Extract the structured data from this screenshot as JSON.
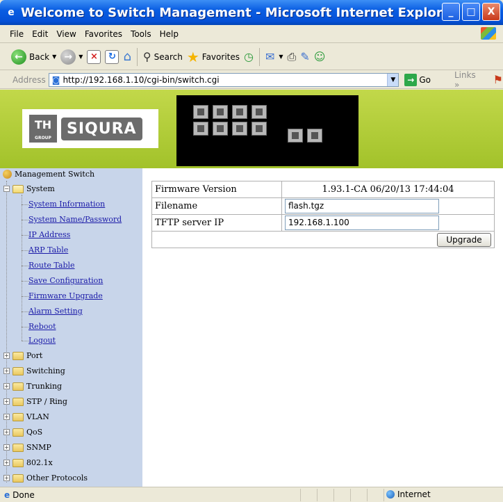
{
  "window": {
    "title": "Welcome to Switch Management - Microsoft Internet Explorer",
    "buttons": [
      "_",
      "□",
      "X"
    ]
  },
  "menu": [
    "File",
    "Edit",
    "View",
    "Favorites",
    "Tools",
    "Help"
  ],
  "toolbar": {
    "back_label": "Back",
    "search_label": "Search",
    "favorites_label": "Favorites"
  },
  "address": {
    "label": "Address",
    "url": "http://192.168.1.10/cgi-bin/switch.cgi",
    "go_label": "Go",
    "links_label": "Links"
  },
  "banner": {
    "logo_group": "TH",
    "logo_group_sub": "GROUP",
    "logo_brand": "SIQURA"
  },
  "sidebar": {
    "root": "Management Switch",
    "system": "System",
    "system_items": [
      "System Information",
      "System Name/Password",
      "IP Address",
      "ARP Table",
      "Route Table",
      "Save Configuration",
      "Firmware Upgrade",
      "Alarm Setting",
      "Reboot",
      "Logout"
    ],
    "folders": [
      "Port",
      "Switching",
      "Trunking",
      "STP / Ring",
      "VLAN",
      "QoS",
      "SNMP",
      "802.1x",
      "Other Protocols"
    ]
  },
  "form": {
    "firmware_label": "Firmware Version",
    "firmware_value": "1.93.1-CA 06/20/13 17:44:04",
    "filename_label": "Filename",
    "filename_value": "flash.tgz",
    "tftp_label": "TFTP server IP",
    "tftp_value": "192.168.1.100",
    "upgrade_label": "Upgrade"
  },
  "status": {
    "left": "Done",
    "zone": "Internet"
  },
  "colors": {
    "titlebar": "#0a5ee3",
    "banner": "#b4cc36",
    "sidebar": "#c8d5ea",
    "link": "#1a1aa8"
  }
}
